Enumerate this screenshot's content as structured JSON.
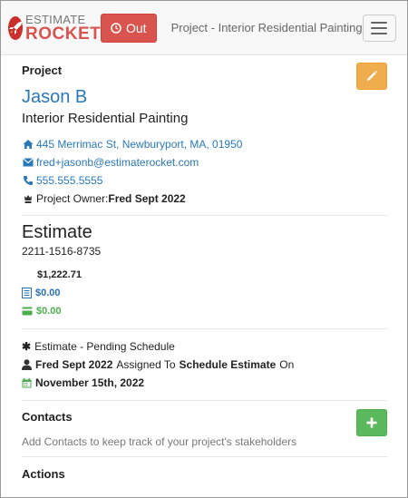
{
  "navbar": {
    "logo_top": "ESTIMATE",
    "logo_bottom": "ROCKET",
    "out_label": "Out",
    "title": "Project - Interior Residential Painting"
  },
  "project": {
    "heading": "Project",
    "client_name": "Jason B",
    "project_name": "Interior Residential Painting",
    "address": "445 Merrimac St, Newburyport, MA, 01950",
    "email": "fred+jasonb@estimaterocket.com",
    "phone": "555.555.5555",
    "owner_label": "Project Owner:",
    "owner_name": "Fred Sept 2022"
  },
  "estimate": {
    "title": "Estimate",
    "number": "2211-1516-8735",
    "total": "$1,222.71",
    "invoiced": "$0.00",
    "paid": "$0.00",
    "status": "Estimate - Pending Schedule",
    "assignee": "Fred Sept 2022",
    "assigned_to_text": "Assigned To",
    "task": "Schedule Estimate",
    "on_text": "On",
    "date": "November 15th, 2022"
  },
  "contacts": {
    "heading": "Contacts",
    "empty_text": "Add Contacts to keep track of your project's stakeholders"
  },
  "actions": {
    "heading": "Actions"
  },
  "colors": {
    "brand_red": "#d9534f",
    "link_blue": "#2a78b8",
    "edit_orange": "#f0ad4e",
    "success_green": "#5cb85c"
  }
}
